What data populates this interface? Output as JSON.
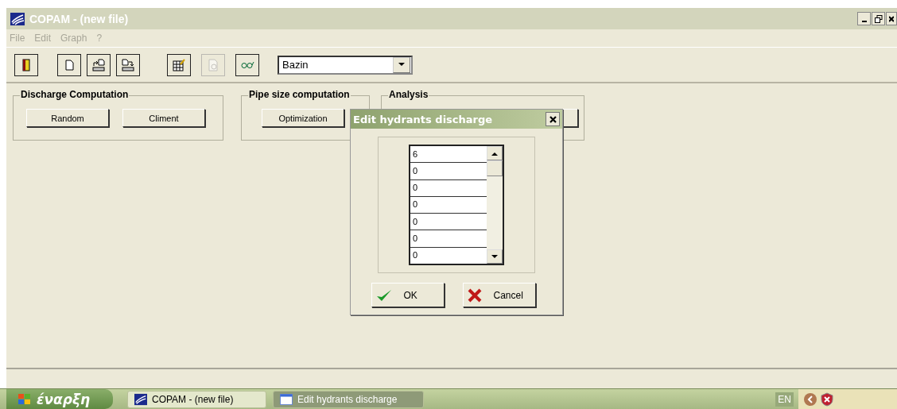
{
  "window": {
    "title": "COPAM - (new file)"
  },
  "menu": [
    {
      "label": "File",
      "disabled": true
    },
    {
      "label": "Edit",
      "disabled": true
    },
    {
      "label": "Graph",
      "disabled": true
    },
    {
      "label": "?",
      "disabled": true
    }
  ],
  "toolbar": {
    "buttons": [
      {
        "kind": "exit",
        "disabled": false
      },
      {
        "kind": "new",
        "disabled": false
      },
      {
        "kind": "import",
        "disabled": false
      },
      {
        "kind": "export",
        "disabled": false
      },
      {
        "kind": "table",
        "disabled": false
      },
      {
        "kind": "preview",
        "disabled": true
      },
      {
        "kind": "glasses",
        "disabled": false
      }
    ],
    "formula": "Bazin"
  },
  "groups": [
    {
      "title": "Discharge Computation",
      "buttons": [
        "Random",
        "Climent"
      ]
    },
    {
      "title": "Pipe size computation",
      "buttons": [
        "Optimization"
      ]
    },
    {
      "title": "Analysis"
    }
  ],
  "dialog": {
    "title": "Edit hydrants discharge",
    "values": [
      "6",
      "0",
      "0",
      "0",
      "0",
      "0",
      "0"
    ],
    "ok": "OK",
    "cancel": "Cancel"
  },
  "taskbar": {
    "start": "έναρξη",
    "tasks": [
      {
        "label": "COPAM - (new file)",
        "kind": "app",
        "selected": false
      },
      {
        "label": "Edit hydrants discharge",
        "kind": "dialog",
        "selected": true
      }
    ],
    "language": "EN"
  }
}
